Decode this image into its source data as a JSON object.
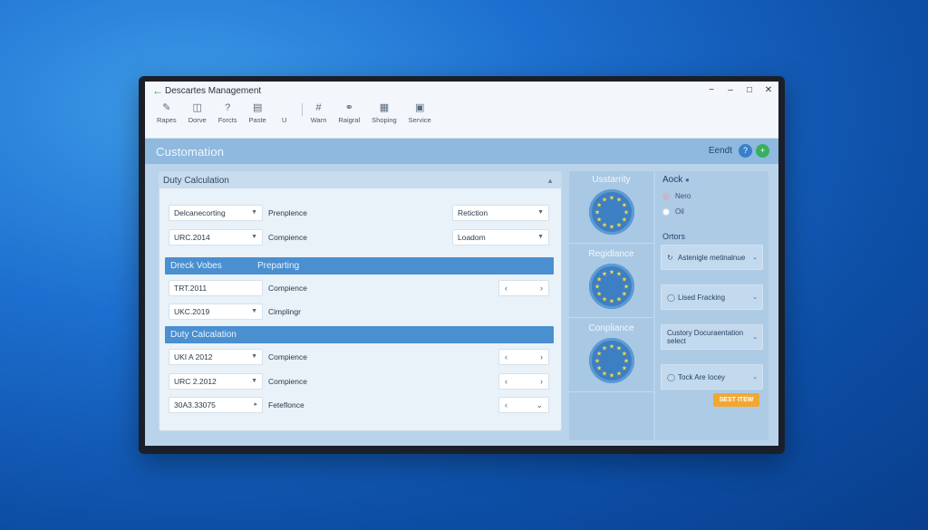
{
  "window": {
    "title": "Descartes Management",
    "controls": [
      "−",
      "–",
      "□",
      "✕"
    ]
  },
  "ribbon": {
    "items": [
      {
        "label": "Rapes",
        "icon": "pencil-icon"
      },
      {
        "label": "Dorve",
        "icon": "document-icon"
      },
      {
        "label": "Forcts",
        "icon": "question-icon"
      },
      {
        "label": "Paste",
        "icon": "clipboard-icon"
      },
      {
        "label": "U",
        "icon": ""
      },
      {
        "label": "Warn",
        "icon": "grid-icon"
      },
      {
        "label": "Raigral",
        "icon": "globe-icon"
      },
      {
        "label": "Shoping",
        "icon": "receipt-icon"
      },
      {
        "label": "Service",
        "icon": "lock-icon"
      }
    ]
  },
  "header": {
    "title": "Customation",
    "right_label": "Eendt"
  },
  "panel": {
    "title": "Duty Calculation",
    "rows_top": [
      {
        "select": "Delcanecorting",
        "label": "Prenplence",
        "right_select": "Retiction"
      },
      {
        "select": "URC.2014",
        "label": "Compience",
        "right_select": "Loadom"
      }
    ],
    "section1": {
      "left": "Dreck Vobes",
      "right": "Preparting"
    },
    "rows_mid": [
      {
        "select": "TRT.2011",
        "label": "Compience",
        "nav": true
      },
      {
        "select": "UKC.2019",
        "label": "Cimplingr",
        "nav": false
      }
    ],
    "section2": {
      "left": "Duty Calcalation"
    },
    "rows_bottom": [
      {
        "select": "UKI A 2012",
        "label": "Compience"
      },
      {
        "select": "URC 2.2012",
        "label": "Compience"
      },
      {
        "select": "30A3.33075",
        "label": "Feteflonce"
      }
    ]
  },
  "middle": {
    "cards": [
      "Usstarrity",
      "Regidlance",
      "Conpliance"
    ]
  },
  "right": {
    "title": "Aock",
    "radios": [
      {
        "label": "Nero",
        "checked": false
      },
      {
        "label": "Oil",
        "checked": true
      }
    ],
    "options_title": "Ortors",
    "options": [
      "Astenigle metinalnue",
      "Lised Fracking",
      "Custory Docuraentation select",
      "Tock Are Iocey"
    ],
    "button": "SEST ITEW"
  },
  "colors": {
    "accent": "#4a8fd0",
    "button": "#f1a833",
    "header": "#8fb9df"
  }
}
